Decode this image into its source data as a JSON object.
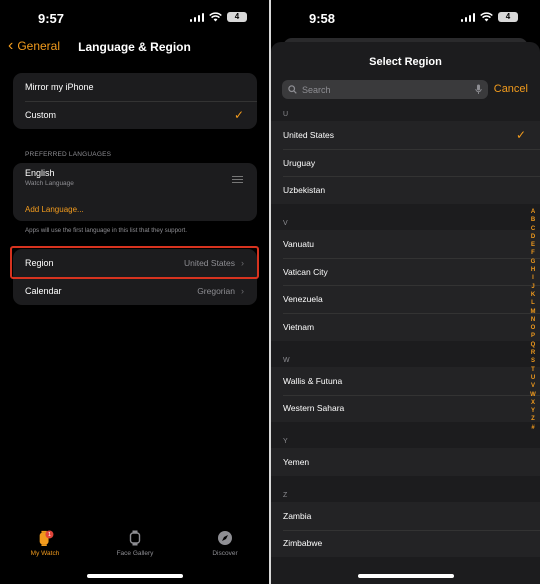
{
  "left": {
    "status": {
      "time": "9:57",
      "battery": "4"
    },
    "nav": {
      "back_label": "General",
      "title": "Language & Region"
    },
    "mirror_label": "Mirror my iPhone",
    "custom_label": "Custom",
    "preferred_header": "PREFERRED LANGUAGES",
    "language": {
      "name": "English",
      "sub": "Watch Language"
    },
    "add_language": "Add Language...",
    "footnote": "Apps will use the first language in this list that they support.",
    "region": {
      "label": "Region",
      "value": "United States"
    },
    "calendar": {
      "label": "Calendar",
      "value": "Gregorian"
    },
    "tabs": {
      "my_watch": "My Watch",
      "my_watch_badge": "1",
      "face_gallery": "Face Gallery",
      "discover": "Discover"
    }
  },
  "right": {
    "status": {
      "time": "9:58",
      "battery": "4"
    },
    "sheet_title": "Select Region",
    "search_placeholder": "Search",
    "cancel": "Cancel",
    "sections": [
      {
        "letter": "U",
        "items": [
          "United States",
          "Uruguay",
          "Uzbekistan"
        ]
      },
      {
        "letter": "V",
        "items": [
          "Vanuatu",
          "Vatican City",
          "Venezuela",
          "Vietnam"
        ]
      },
      {
        "letter": "W",
        "items": [
          "Wallis & Futuna",
          "Western Sahara"
        ]
      },
      {
        "letter": "Y",
        "items": [
          "Yemen"
        ]
      },
      {
        "letter": "Z",
        "items": [
          "Zambia",
          "Zimbabwe"
        ]
      }
    ],
    "index": [
      "A",
      "B",
      "C",
      "D",
      "E",
      "F",
      "G",
      "H",
      "I",
      "J",
      "K",
      "L",
      "M",
      "N",
      "O",
      "P",
      "Q",
      "R",
      "S",
      "T",
      "U",
      "V",
      "W",
      "X",
      "Y",
      "Z",
      "#"
    ]
  },
  "colors": {
    "accent": "#f29b1d",
    "highlight_border": "#d7331f"
  },
  "icons": [
    "chevron-left-icon",
    "checkmark-icon",
    "reorder-handle-icon",
    "chevron-right-icon",
    "watch-icon",
    "face-gallery-icon",
    "compass-icon",
    "search-icon",
    "microphone-icon",
    "wifi-icon",
    "signal-icon",
    "battery-icon"
  ]
}
